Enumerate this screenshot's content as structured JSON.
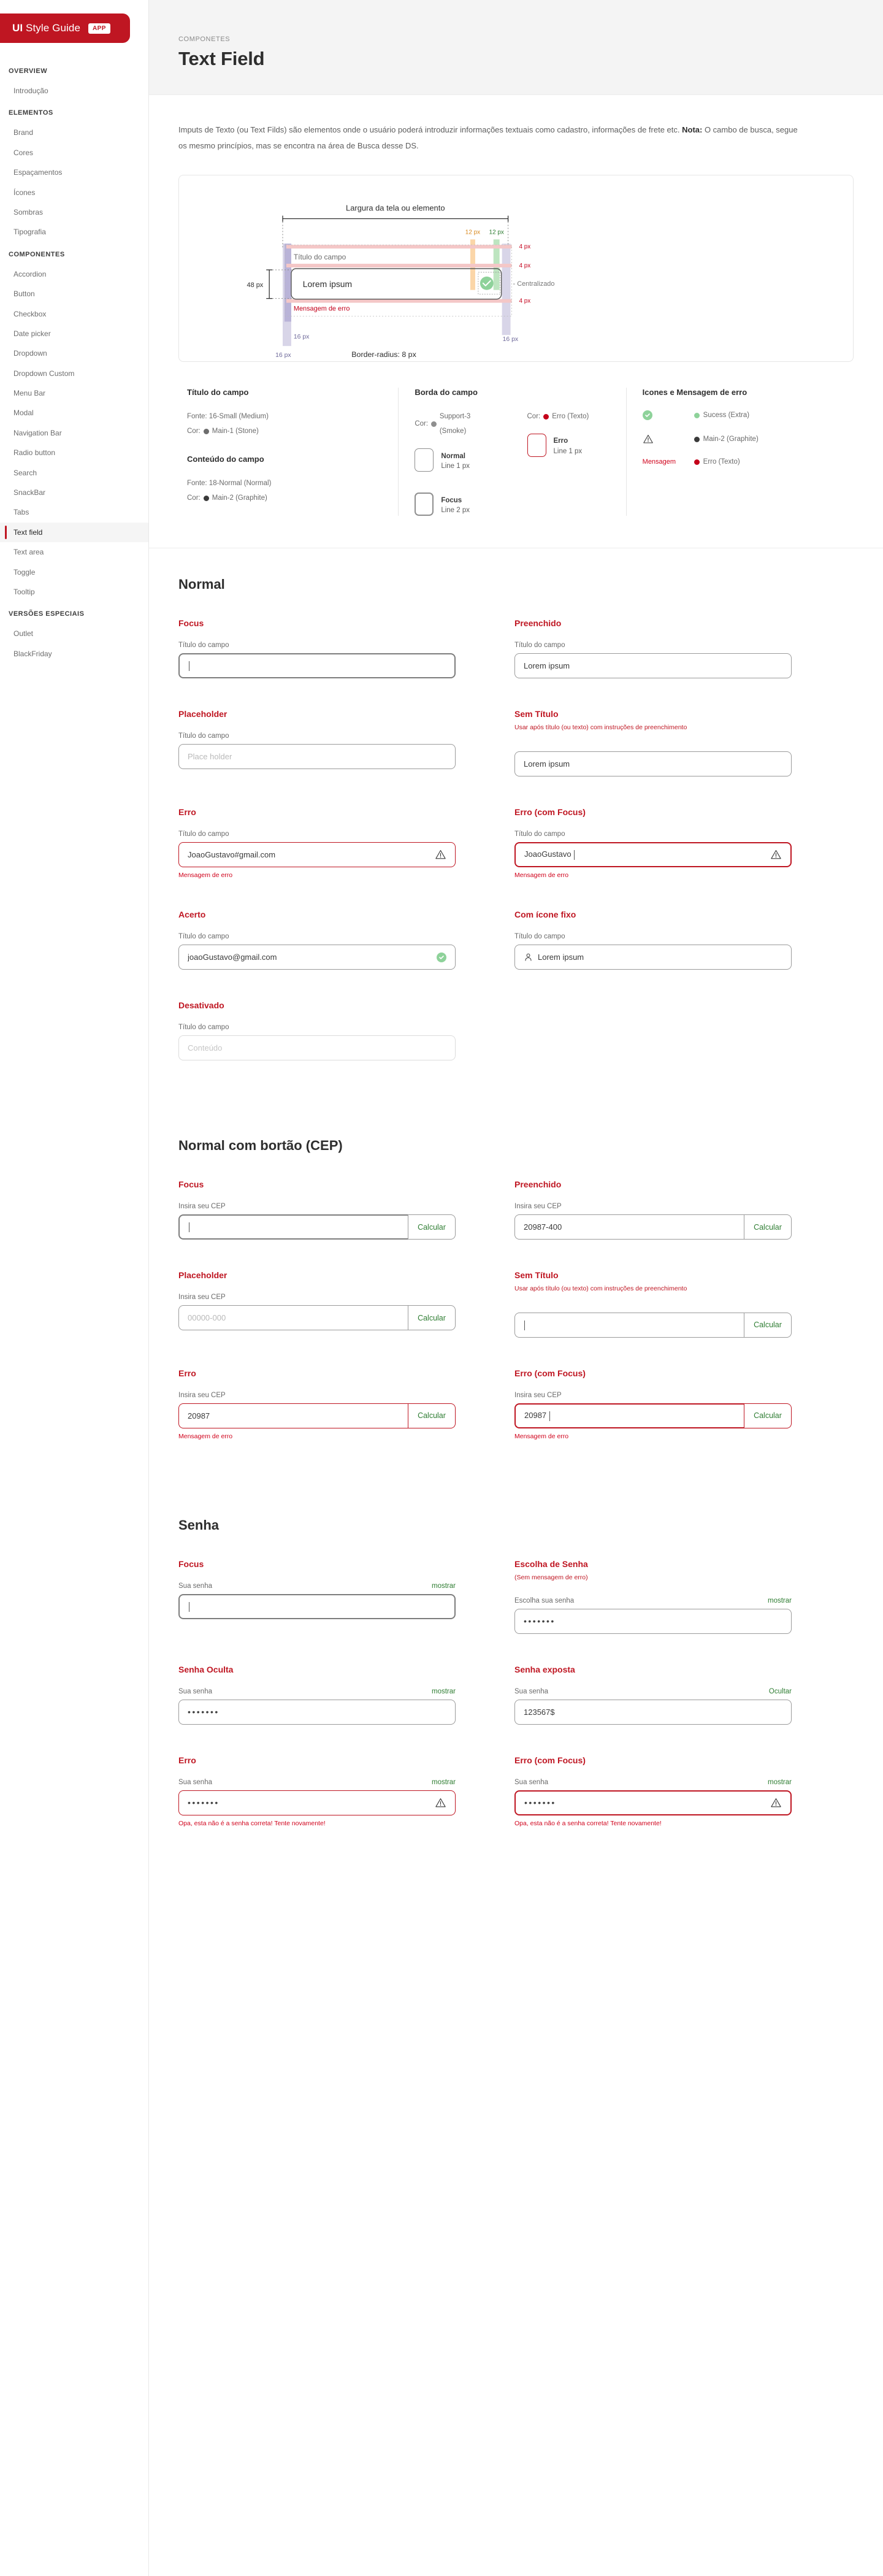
{
  "brand": {
    "title_bold": "UI",
    "title_rest": " Style Guide",
    "badge": "APP"
  },
  "sidebar": {
    "groups": [
      {
        "title": "OVERVIEW",
        "items": [
          {
            "label": "Introdução",
            "active": false
          }
        ]
      },
      {
        "title": "ELEMENTOS",
        "items": [
          {
            "label": "Brand",
            "active": false
          },
          {
            "label": "Cores",
            "active": false
          },
          {
            "label": "Espaçamentos",
            "active": false
          },
          {
            "label": "Ícones",
            "active": false
          },
          {
            "label": "Sombras",
            "active": false
          },
          {
            "label": "Tipografia",
            "active": false
          }
        ]
      },
      {
        "title": "COMPONENTES",
        "items": [
          {
            "label": "Accordion",
            "active": false
          },
          {
            "label": "Button",
            "active": false
          },
          {
            "label": "Checkbox",
            "active": false
          },
          {
            "label": "Date picker",
            "active": false
          },
          {
            "label": "Dropdown",
            "active": false
          },
          {
            "label": "Dropdown Custom",
            "active": false
          },
          {
            "label": "Menu Bar",
            "active": false
          },
          {
            "label": "Modal",
            "active": false
          },
          {
            "label": "Navigation Bar",
            "active": false
          },
          {
            "label": "Radio button",
            "active": false
          },
          {
            "label": "Search",
            "active": false
          },
          {
            "label": "SnackBar",
            "active": false
          },
          {
            "label": "Tabs",
            "active": false
          },
          {
            "label": "Text field",
            "active": true
          },
          {
            "label": "Text area",
            "active": false
          },
          {
            "label": "Toggle",
            "active": false
          },
          {
            "label": "Tooltip",
            "active": false
          }
        ]
      },
      {
        "title": "VERSÕES ESPECIAIS",
        "items": [
          {
            "label": "Outlet",
            "active": false
          },
          {
            "label": "BlackFriday",
            "active": false
          }
        ]
      }
    ]
  },
  "header": {
    "breadcrumb": "COMPONETES",
    "title": "Text Field"
  },
  "intro": {
    "line1": "Imputs de Texto (ou Text Filds) são elementos onde  o usuário poderá introduzir informações textuais como cadastro, informações",
    "line2_prefix": "de frete etc. ",
    "line2_bold": "Nota:",
    "line2_rest": " O cambo de busca, segue os mesmo princípios, mas se encontra na área de Busca desse DS."
  },
  "diagram": {
    "width_label": "Largura da tela ou elemento",
    "px12_a": "12 px",
    "px12_b": "12 px",
    "px4_a": "4 px",
    "px4_b": "4 px",
    "px4_c": "4 px",
    "px48": "48 px",
    "px16_left_inner": "16 px",
    "px16_right_inner": "16 px",
    "px16_left_outer": "16 px",
    "field_title": "Título do campo",
    "field_value": "Lorem ipsum",
    "centered": "- Centralizado",
    "error_msg": "Mensagem de erro",
    "border_radius": "Border-radius: 8 px"
  },
  "specs": {
    "col1": {
      "h1": "Título do campo",
      "font1": "Fonte: 16-Small (Medium)",
      "color1_prefix": "Cor:",
      "color1": "Main-1 (Stone)",
      "color1_hex": "#6d6d6d",
      "h2": "Conteúdo do campo",
      "font2": "Fonte: 18-Normal (Normal)",
      "color2_prefix": "Cor:",
      "color2": "Main-2 (Graphite)",
      "color2_hex": "#3a3a3a"
    },
    "col2": {
      "h": "Borda do campo",
      "left_color_prefix": "Cor:",
      "left_color": "Support-3 (Smoke)",
      "left_color_hex": "#8f8f8f",
      "right_color_prefix": "Cor:",
      "right_color": "Erro (Texto)",
      "right_color_hex": "#bf1622",
      "normal_label": "Normal",
      "normal_sub": "Line 1 px",
      "erro_label": "Erro",
      "erro_sub": "Line 1 px",
      "focus_label": "Focus",
      "focus_sub": "Line 2 px"
    },
    "col3": {
      "h": "Icones e Mensagem de erro",
      "r1_label": "Sucess (Extra)",
      "r1_hex": "#8ed29a",
      "r2_label": "Main-2 (Graphite)",
      "r2_hex": "#3a3a3a",
      "r3_icon_text": "Mensagem",
      "r3_label": "Erro (Texto)",
      "r3_hex": "#c4001a"
    }
  },
  "sections": {
    "normal": {
      "title": "Normal",
      "cells": [
        {
          "title": "Focus",
          "label": "Título do campo",
          "state": "focus",
          "value": "",
          "caret": true
        },
        {
          "title": "Preenchido",
          "label": "Título do campo",
          "state": "normal",
          "value": "Lorem ipsum"
        },
        {
          "title": "Placeholder",
          "label": "Título do campo",
          "state": "normal",
          "value": "Place holder",
          "placeholder": true
        },
        {
          "title": "Sem Título",
          "note": "Usar após título (ou texto) com instruções de preenchimento",
          "label": "",
          "state": "normal",
          "value": "Lorem ipsum"
        },
        {
          "title": "Erro",
          "label": "Título do campo",
          "state": "error",
          "value": "JoaoGustavo#gmail.com",
          "icon": "warning-icon",
          "helper": "Mensagem de erro"
        },
        {
          "title": "Erro (com Focus)",
          "label": "Título do campo",
          "state": "error-focus",
          "value": "JoaoGustavo ",
          "caret": true,
          "icon": "warning-icon",
          "helper": "Mensagem de erro"
        },
        {
          "title": "Acerto",
          "label": "Título do campo",
          "state": "normal",
          "value": "joaoGustavo@gmail.com",
          "icon": "check-circle-icon"
        },
        {
          "title": "Com ícone fixo",
          "label": "Título do campo",
          "state": "normal",
          "value": "Lorem ipsum",
          "leading_icon": "person-icon"
        },
        {
          "title": "Desativado",
          "label": "Título do campo",
          "state": "disabled",
          "value": "Conteúdo"
        }
      ]
    },
    "cep": {
      "title": "Normal com bortão (CEP)",
      "button_label": "Calcular",
      "cells": [
        {
          "title": "Focus",
          "label": "Insira seu CEP",
          "state": "focus",
          "value": "",
          "caret": true
        },
        {
          "title": "Preenchido",
          "label": "Insira seu CEP",
          "state": "normal",
          "value": "20987-400"
        },
        {
          "title": "Placeholder",
          "label": "Insira seu CEP",
          "state": "normal",
          "value": "00000-000",
          "placeholder": true
        },
        {
          "title": "Sem Título",
          "note": "Usar após título (ou texto) com instruções de preenchimento",
          "label": "",
          "state": "normal",
          "value": "",
          "caret": true
        },
        {
          "title": "Erro",
          "label": "Insira seu CEP",
          "state": "error",
          "value": "20987",
          "helper": "Mensagem de erro"
        },
        {
          "title": "Erro (com Focus)",
          "label": "Insira seu CEP",
          "state": "error-focus",
          "value": "20987 ",
          "caret": true,
          "helper": "Mensagem de erro"
        }
      ]
    },
    "senha": {
      "title": "Senha",
      "cells": [
        {
          "title": "Focus",
          "label": "Sua senha",
          "action": "mostrar",
          "state": "focus",
          "value": "",
          "caret": true
        },
        {
          "title": "Escolha de Senha",
          "note": "(Sem mensagem de erro)",
          "label": "Escolha sua senha",
          "action": "mostrar",
          "state": "normal",
          "value": "•••••••",
          "dots": true
        },
        {
          "title": "Senha Oculta",
          "label": "Sua senha",
          "action": "mostrar",
          "state": "normal",
          "value": "•••••••",
          "dots": true
        },
        {
          "title": "Senha exposta",
          "label": "Sua senha",
          "action": "Ocultar",
          "state": "normal",
          "value": "123567$"
        },
        {
          "title": "Erro",
          "label": "Sua senha",
          "action": "mostrar",
          "state": "error",
          "value": "•••••••",
          "dots": true,
          "icon": "warning-icon",
          "helper": "Opa, esta não é a senha correta! Tente novamente!"
        },
        {
          "title": "Erro (com Focus)",
          "label": "Sua senha",
          "action": "mostrar",
          "state": "error-focus",
          "value": "•••••••",
          "dots": true,
          "icon": "warning-icon",
          "helper": "Opa, esta não é a senha correta! Tente novamente!"
        }
      ]
    }
  },
  "colors": {
    "brand_red": "#bf1622",
    "error_red": "#c4001a",
    "success_green": "#8ed29a",
    "action_green": "#2e7d32"
  }
}
